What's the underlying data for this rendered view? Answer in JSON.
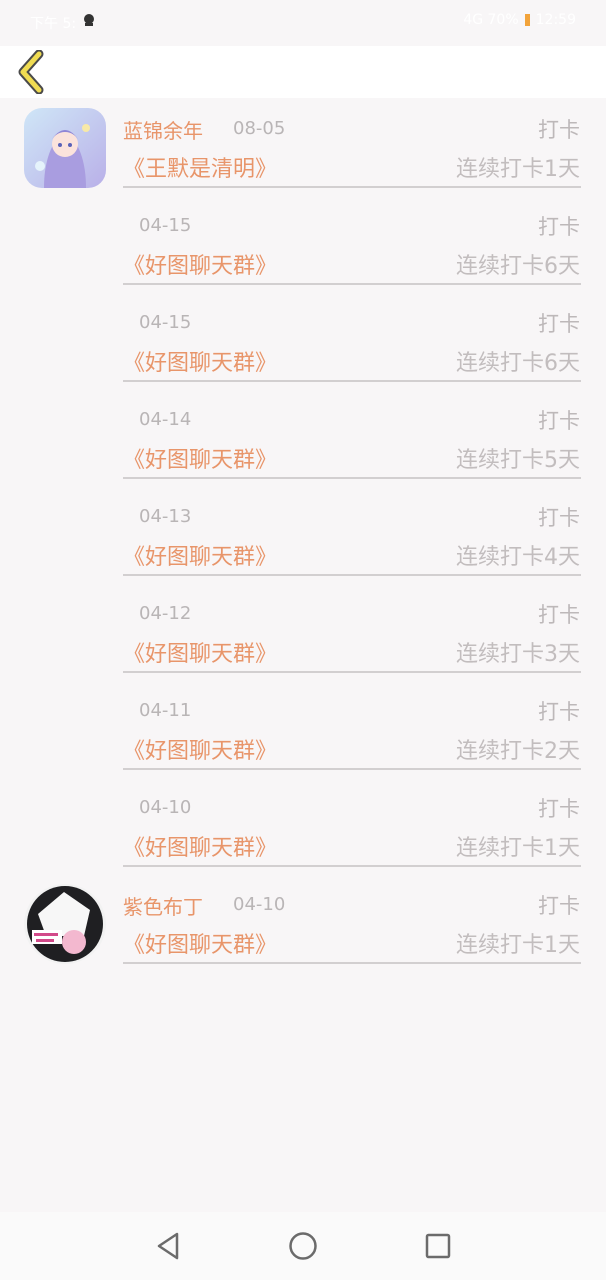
{
  "status_bar": {
    "time_text": "下午 5:",
    "right_text": "4G 70%",
    "clock": "12:59",
    "battery_color": "#f2a33a"
  },
  "header": {
    "back_icon": "chevron-left-icon",
    "back_color": "#f0dc52"
  },
  "colors": {
    "accent": "#e8956a",
    "muted": "#b9b5b6",
    "divider": "#d2cfd0",
    "background": "#f8f6f7"
  },
  "entries": [
    {
      "name": "蓝锦余年",
      "date": "08-05",
      "action": "打卡",
      "group": "《王默是清明》",
      "streak": "连续打卡1天",
      "avatar": "anime-girl-avatar"
    },
    {
      "date": "04-15",
      "action": "打卡",
      "group": "《好图聊天群》",
      "streak": "连续打卡6天"
    },
    {
      "date": "04-15",
      "action": "打卡",
      "group": "《好图聊天群》",
      "streak": "连续打卡6天"
    },
    {
      "date": "04-14",
      "action": "打卡",
      "group": "《好图聊天群》",
      "streak": "连续打卡5天"
    },
    {
      "date": "04-13",
      "action": "打卡",
      "group": "《好图聊天群》",
      "streak": "连续打卡4天"
    },
    {
      "date": "04-12",
      "action": "打卡",
      "group": "《好图聊天群》",
      "streak": "连续打卡3天"
    },
    {
      "date": "04-11",
      "action": "打卡",
      "group": "《好图聊天群》",
      "streak": "连续打卡2天"
    },
    {
      "date": "04-10",
      "action": "打卡",
      "group": "《好图聊天群》",
      "streak": "连续打卡1天"
    },
    {
      "name": "紫色布丁",
      "date": "04-10",
      "action": "打卡",
      "group": "《好图聊天群》",
      "streak": "连续打卡1天",
      "avatar": "photo-avatar"
    }
  ],
  "nav_bar": {
    "back_icon": "triangle-back-icon",
    "home_icon": "circle-home-icon",
    "recent_icon": "square-recents-icon"
  }
}
